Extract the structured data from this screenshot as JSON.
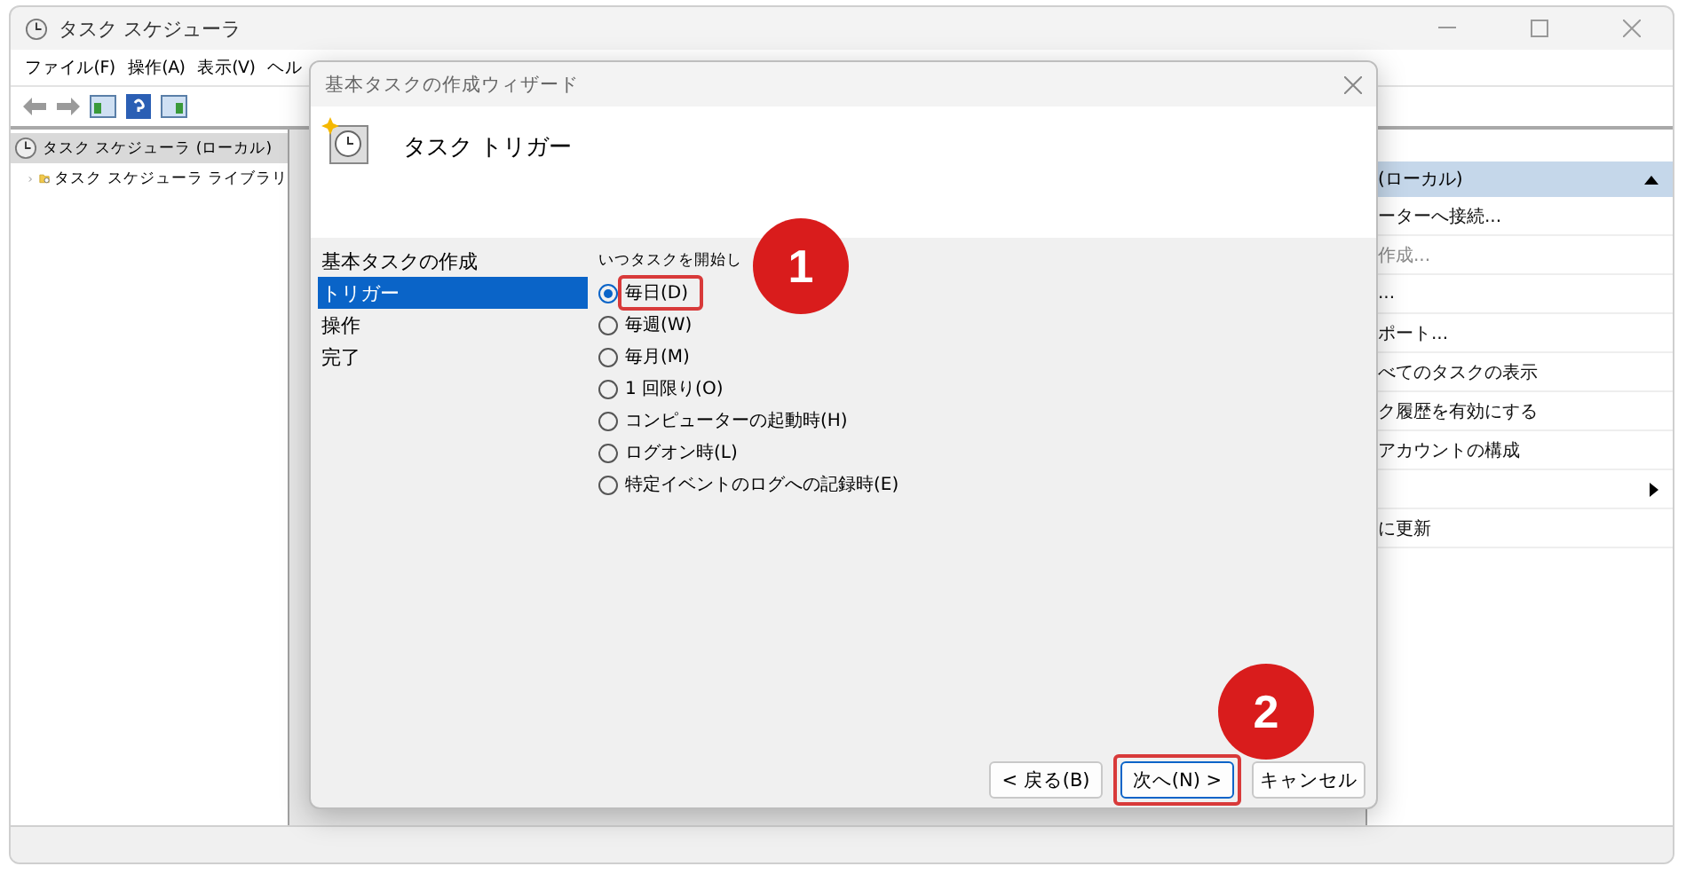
{
  "window": {
    "title": "タスク スケジューラ"
  },
  "menu": [
    "ファイル(F)",
    "操作(A)",
    "表示(V)",
    "ヘル"
  ],
  "tree": [
    {
      "label": "タスク スケジューラ (ローカル)",
      "selected": true,
      "children": [
        {
          "label": "タスク スケジューラ ライブラリ",
          "selected": false
        }
      ]
    }
  ],
  "actions": {
    "header": "(ローカル)",
    "items": [
      {
        "label": "ーターへ接続...",
        "disabled": false,
        "kind": "item"
      },
      {
        "label": "作成...",
        "disabled": true,
        "kind": "item"
      },
      {
        "label": "...",
        "disabled": false,
        "kind": "item"
      },
      {
        "label": "ポート...",
        "disabled": false,
        "kind": "item"
      },
      {
        "label": "べてのタスクの表示",
        "disabled": false,
        "kind": "item"
      },
      {
        "label": "ク履歴を有効にする",
        "disabled": false,
        "kind": "item"
      },
      {
        "label": "アカウントの構成",
        "disabled": false,
        "kind": "item"
      },
      {
        "kind": "submenu"
      },
      {
        "label": "に更新",
        "disabled": false,
        "kind": "item"
      }
    ]
  },
  "dialog": {
    "title": "基本タスクの作成ウィザード",
    "heading": "タスク トリガー",
    "steps": [
      {
        "label": "基本タスクの作成",
        "selected": false
      },
      {
        "label": "トリガー",
        "selected": true
      },
      {
        "label": "操作",
        "selected": false
      },
      {
        "label": "完了",
        "selected": false
      }
    ],
    "question": "いつタスクを開始し",
    "options": [
      {
        "label": "毎日(D)",
        "selected": true,
        "highlighted": true
      },
      {
        "label": "毎週(W)",
        "selected": false
      },
      {
        "label": "毎月(M)",
        "selected": false
      },
      {
        "label": "1 回限り(O)",
        "selected": false
      },
      {
        "label": "コンピューターの起動時(H)",
        "selected": false
      },
      {
        "label": "ログオン時(L)",
        "selected": false
      },
      {
        "label": "特定イベントのログへの記録時(E)",
        "selected": false
      }
    ],
    "buttons": [
      {
        "label": "< 戻る(B)",
        "focused": false
      },
      {
        "label": "次へ(N) >",
        "focused": true,
        "highlighted": true
      },
      {
        "label": "キャンセル",
        "focused": false
      }
    ]
  },
  "annotations": [
    {
      "number": "1"
    },
    {
      "number": "2"
    }
  ]
}
